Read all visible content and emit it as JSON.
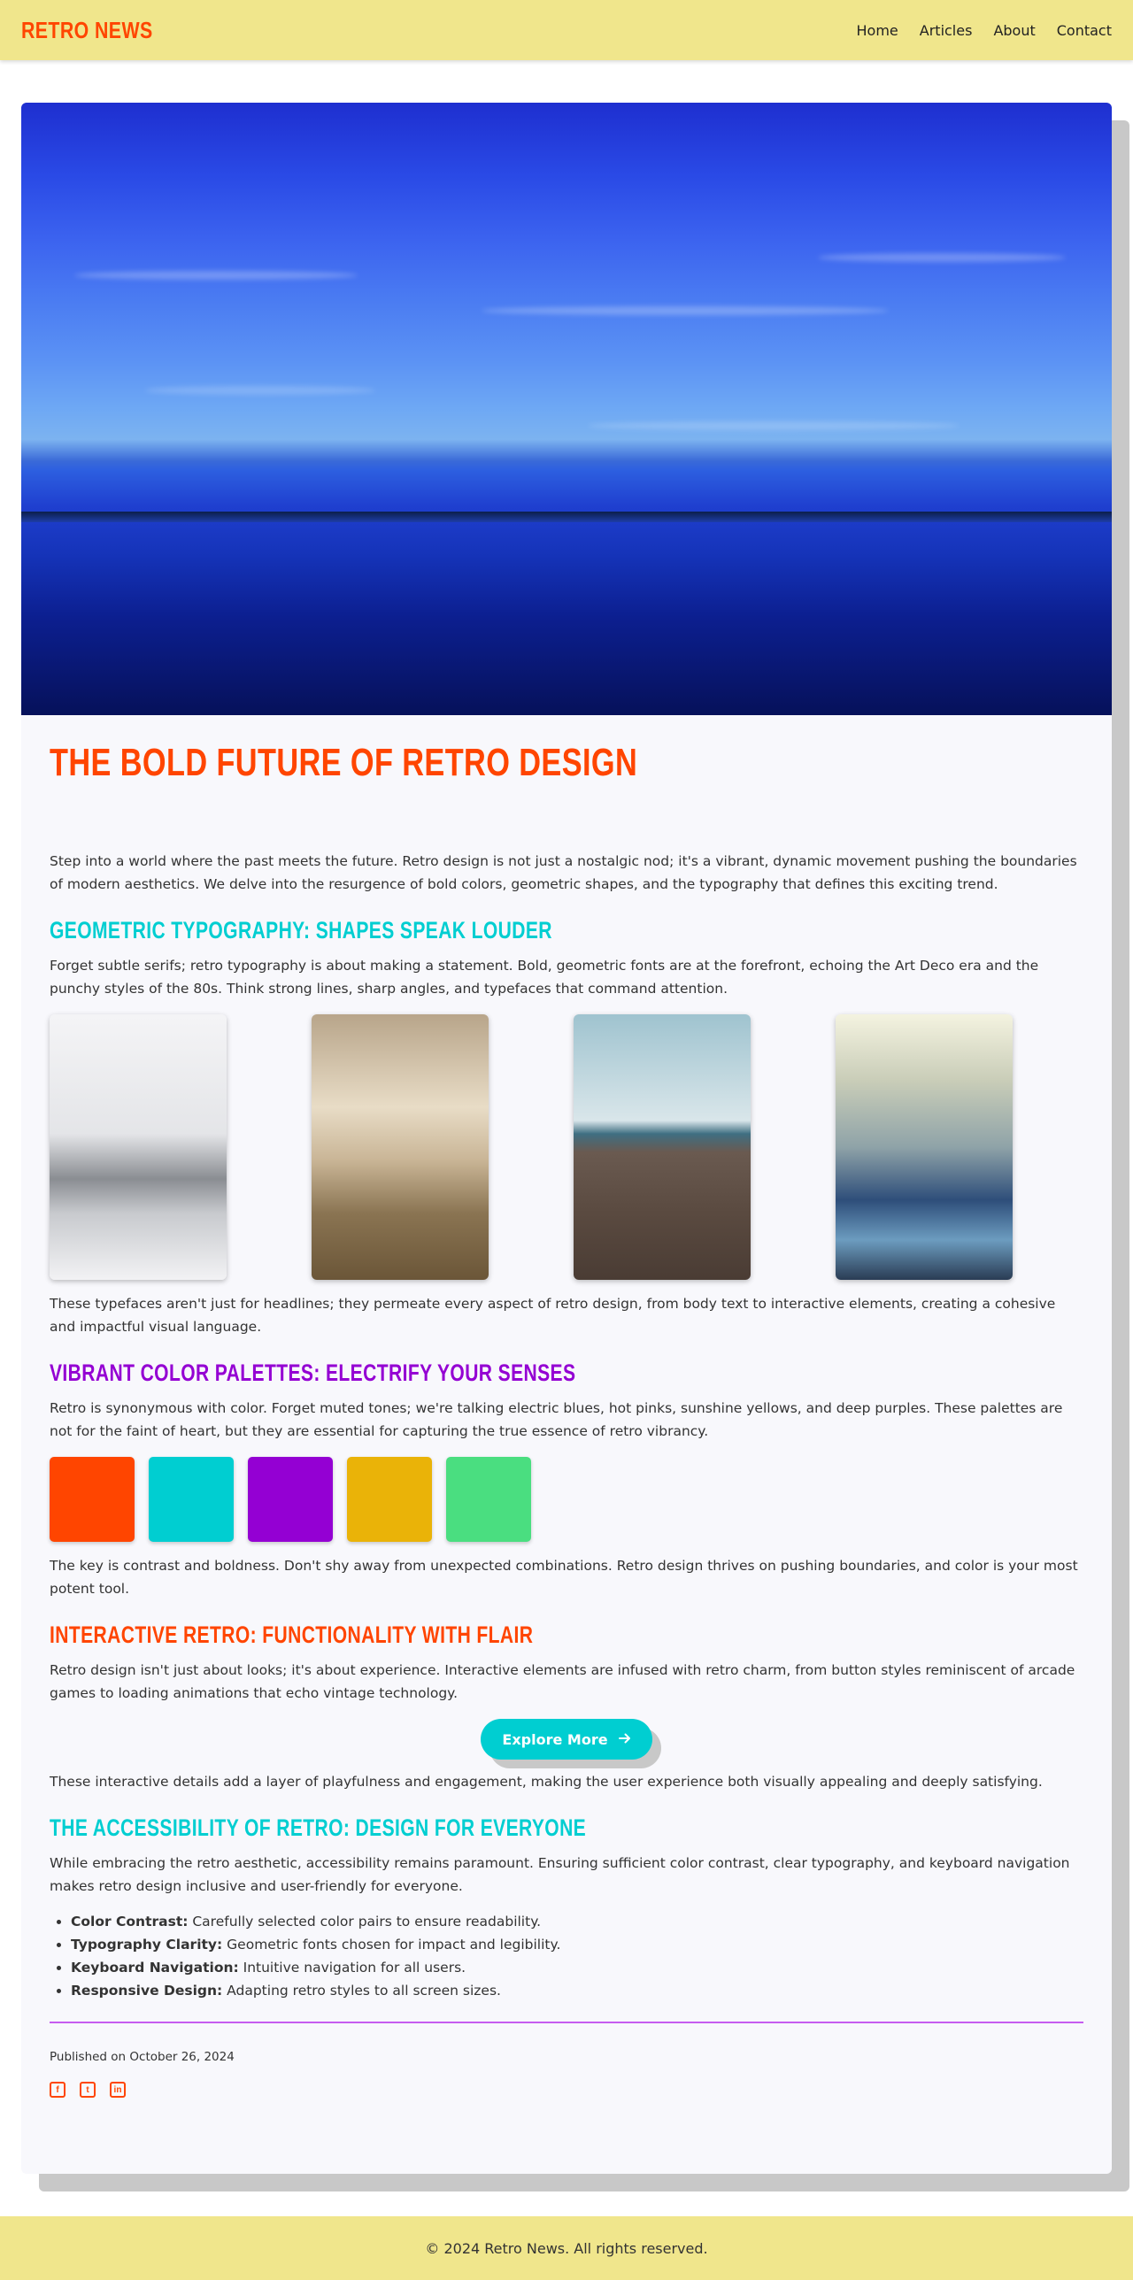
{
  "header": {
    "brand": "RETRO NEWS",
    "nav": [
      "Home",
      "Articles",
      "About",
      "Contact"
    ]
  },
  "article": {
    "title": "THE BOLD FUTURE OF RETRO DESIGN",
    "intro": "Step into a world where the past meets the future. Retro design is not just a nostalgic nod; it's a vibrant, dynamic movement pushing the boundaries of modern aesthetics. We delve into the resurgence of bold colors, geometric shapes, and the typography that defines this exciting trend.",
    "sections": [
      {
        "heading": "GEOMETRIC TYPOGRAPHY: SHAPES SPEAK LOUDER",
        "body": "Forget subtle serifs; retro typography is about making a statement. Bold, geometric fonts are at the forefront, echoing the Art Deco era and the punchy styles of the 80s. Think strong lines, sharp angles, and typefaces that command attention.",
        "after": "These typefaces aren't just for headlines; they permeate every aspect of retro design, from body text to interactive elements, creating a cohesive and impactful visual language."
      },
      {
        "heading": "VIBRANT COLOR PALETTES: ELECTRIFY YOUR SENSES",
        "body": "Retro is synonymous with color. Forget muted tones; we're talking electric blues, hot pinks, sunshine yellows, and deep purples. These palettes are not for the faint of heart, but they are essential for capturing the true essence of retro vibrancy.",
        "after": "The key is contrast and boldness. Don't shy away from unexpected combinations. Retro design thrives on pushing boundaries, and color is your most potent tool."
      },
      {
        "heading": "INTERACTIVE RETRO: FUNCTIONALITY WITH FLAIR",
        "body": "Retro design isn't just about looks; it's about experience. Interactive elements are infused with retro charm, from button styles reminiscent of arcade games to loading animations that echo vintage technology.",
        "after": "These interactive details add a layer of playfulness and engagement, making the user experience both visually appealing and deeply satisfying."
      },
      {
        "heading": "THE ACCESSIBILITY OF RETRO: DESIGN FOR EVERYONE",
        "body": "While embracing the retro aesthetic, accessibility remains paramount. Ensuring sufficient color contrast, clear typography, and keyboard navigation makes retro design inclusive and user-friendly for everyone."
      }
    ],
    "button_label": "Explore More",
    "bullets": [
      {
        "term": "Color Contrast:",
        "text": " Carefully selected color pairs to ensure readability."
      },
      {
        "term": "Typography Clarity:",
        "text": " Geometric fonts chosen for impact and legibility."
      },
      {
        "term": "Keyboard Navigation:",
        "text": " Intuitive navigation for all users."
      },
      {
        "term": "Responsive Design:",
        "text": " Adapting retro styles to all screen sizes."
      }
    ],
    "published": "Published on October 26, 2024"
  },
  "swatch_colors": [
    "#ff4500",
    "#00ced1",
    "#9400d3",
    "#eab308",
    "#4ade80"
  ],
  "footer": {
    "copyright": "© 2024 Retro News. All rights reserved."
  }
}
